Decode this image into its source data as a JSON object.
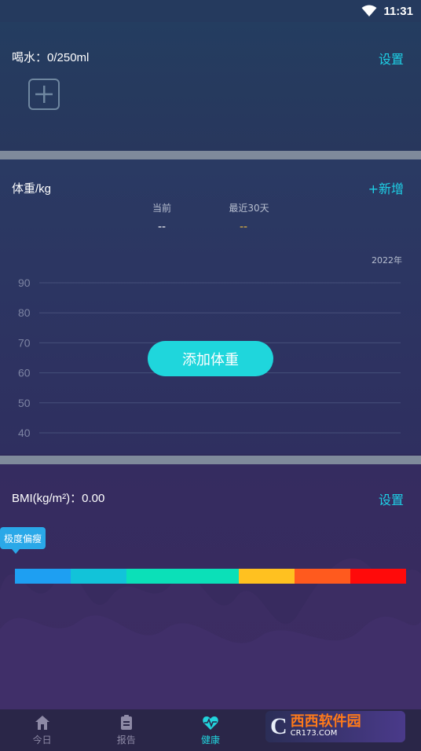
{
  "status": {
    "time": "11:31"
  },
  "water": {
    "title": "喝水：0/250ml",
    "settings_label": "设置"
  },
  "weight": {
    "title": "体重/kg",
    "add_label": "+新增",
    "current_label": "当前",
    "current_value": "--",
    "recent_label": "最近30天",
    "recent_value": "--",
    "year_label": "2022年",
    "add_button_label": "添加体重"
  },
  "chart_data": {
    "type": "line",
    "y_ticks": [
      "90",
      "80",
      "70",
      "60",
      "50",
      "40"
    ],
    "ylim": [
      40,
      90
    ],
    "series": [],
    "grid": true
  },
  "bmi": {
    "title": "BMI(kg/m²)：0.00",
    "settings_label": "设置",
    "bubble_label": "极度偏瘦",
    "segments": [
      {
        "color": "#1e9ff2",
        "weight": 1
      },
      {
        "color": "#12c3d9",
        "weight": 1
      },
      {
        "color": "#0be0b8",
        "weight": 2
      },
      {
        "color": "#ffc120",
        "weight": 1
      },
      {
        "color": "#ff5a1e",
        "weight": 1
      },
      {
        "color": "#ff0a0a",
        "weight": 1
      }
    ]
  },
  "tabs": [
    {
      "label": "今日",
      "icon": "home-icon",
      "active": false
    },
    {
      "label": "报告",
      "icon": "report-icon",
      "active": false
    },
    {
      "label": "健康",
      "icon": "heartbeat-icon",
      "active": true
    },
    {
      "label": "",
      "icon": "tab-icon",
      "active": false
    },
    {
      "label": "",
      "icon": "tab-icon",
      "active": false
    }
  ],
  "watermark": {
    "logo": "C",
    "main": "西西软件园",
    "sub": "CR173.COM"
  },
  "colors": {
    "accent": "#1fd6dc",
    "link": "#1ed0e6"
  }
}
